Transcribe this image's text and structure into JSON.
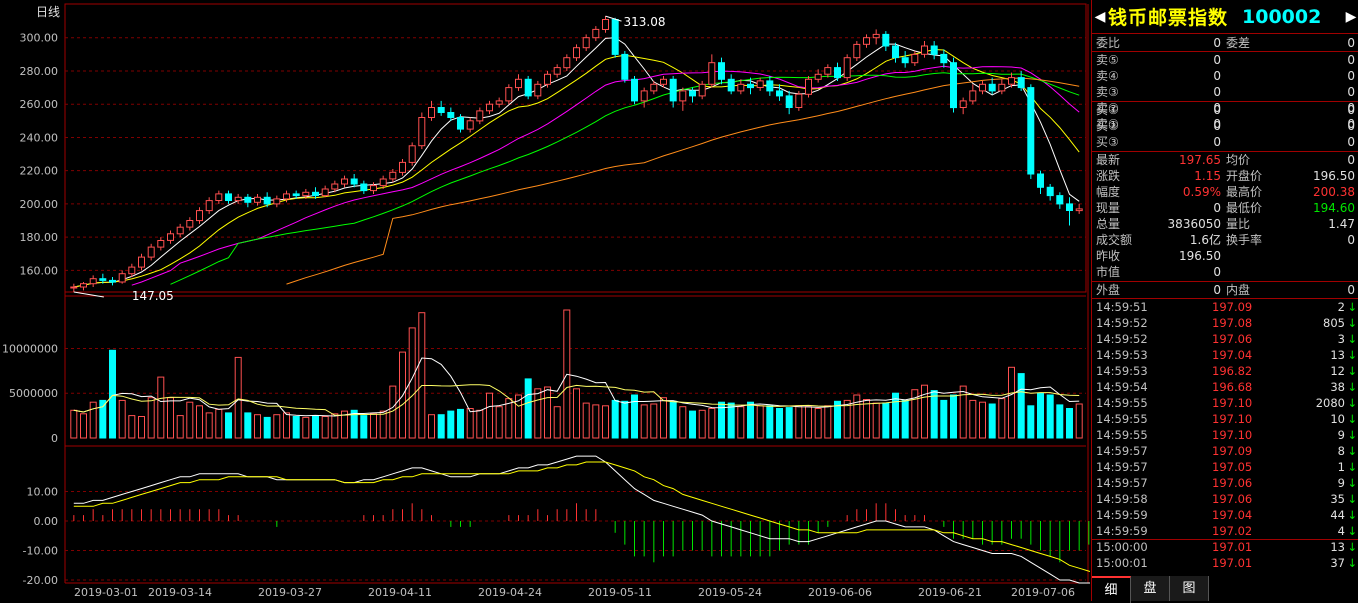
{
  "chart": {
    "period_label": "日线",
    "y_ticks": [
      "300.00",
      "280.00",
      "260.00",
      "240.00",
      "220.00",
      "200.00",
      "180.00",
      "160.00"
    ],
    "high_label": "313.08",
    "low_label": "147.05",
    "vol_ticks": [
      "10000000",
      "5000000",
      "0"
    ],
    "macd_ticks": [
      "10.00",
      "0.00",
      "-10.00",
      "-20.00"
    ],
    "x_labels": [
      "2019-03-01",
      "2019-03-14",
      "2019-03-27",
      "2019-04-11",
      "2019-04-24",
      "2019-05-11",
      "2019-05-24",
      "2019-06-06",
      "2019-06-21",
      "2019-07-06"
    ]
  },
  "chart_data": {
    "type": "candlestick",
    "period": "日线",
    "price_ylim": [
      150,
      313
    ],
    "volume_ylim": [
      0,
      14000000
    ],
    "macd_ylim": [
      -20,
      20
    ],
    "candles": [
      [
        150,
        150,
        147,
        152
      ],
      [
        150,
        152,
        148,
        153
      ],
      [
        152,
        155,
        150,
        157
      ],
      [
        155,
        154,
        152,
        158
      ],
      [
        154,
        153,
        151,
        156
      ],
      [
        153,
        158,
        152,
        160
      ],
      [
        158,
        162,
        156,
        164
      ],
      [
        162,
        168,
        160,
        170
      ],
      [
        168,
        174,
        166,
        176
      ],
      [
        174,
        178,
        172,
        180
      ],
      [
        178,
        182,
        176,
        184
      ],
      [
        182,
        186,
        180,
        188
      ],
      [
        186,
        190,
        184,
        192
      ],
      [
        190,
        196,
        188,
        198
      ],
      [
        196,
        202,
        194,
        204
      ],
      [
        202,
        206,
        200,
        208
      ],
      [
        206,
        202,
        200,
        208
      ],
      [
        202,
        204,
        200,
        206
      ],
      [
        204,
        201,
        198,
        206
      ],
      [
        201,
        204,
        199,
        206
      ],
      [
        204,
        200,
        198,
        207
      ],
      [
        200,
        203,
        198,
        205
      ],
      [
        203,
        206,
        201,
        208
      ],
      [
        206,
        205,
        203,
        208
      ],
      [
        205,
        207,
        203,
        209
      ],
      [
        207,
        205,
        203,
        210
      ],
      [
        205,
        209,
        204,
        211
      ],
      [
        209,
        212,
        207,
        214
      ],
      [
        212,
        215,
        210,
        217
      ],
      [
        215,
        212,
        210,
        218
      ],
      [
        212,
        208,
        206,
        214
      ],
      [
        208,
        211,
        206,
        213
      ],
      [
        211,
        215,
        209,
        217
      ],
      [
        215,
        219,
        213,
        221
      ],
      [
        219,
        225,
        217,
        227
      ],
      [
        225,
        235,
        223,
        237
      ],
      [
        235,
        252,
        233,
        255
      ],
      [
        252,
        258,
        250,
        262
      ],
      [
        258,
        255,
        253,
        262
      ],
      [
        255,
        252,
        250,
        258
      ],
      [
        252,
        245,
        243,
        254
      ],
      [
        245,
        250,
        243,
        252
      ],
      [
        250,
        256,
        248,
        258
      ],
      [
        256,
        260,
        254,
        262
      ],
      [
        260,
        262,
        258,
        264
      ],
      [
        262,
        270,
        260,
        272
      ],
      [
        270,
        275,
        268,
        278
      ],
      [
        275,
        265,
        263,
        277
      ],
      [
        265,
        272,
        263,
        274
      ],
      [
        272,
        278,
        270,
        280
      ],
      [
        278,
        282,
        276,
        284
      ],
      [
        282,
        288,
        280,
        290
      ],
      [
        288,
        294,
        286,
        296
      ],
      [
        294,
        300,
        292,
        302
      ],
      [
        300,
        305,
        298,
        307
      ],
      [
        305,
        311,
        303,
        313
      ],
      [
        311,
        290,
        288,
        312
      ],
      [
        290,
        275,
        273,
        292
      ],
      [
        275,
        262,
        260,
        277
      ],
      [
        262,
        268,
        258,
        270
      ],
      [
        268,
        272,
        266,
        274
      ],
      [
        272,
        275,
        270,
        277
      ],
      [
        275,
        262,
        258,
        277
      ],
      [
        262,
        268,
        256,
        270
      ],
      [
        268,
        265,
        261,
        270
      ],
      [
        265,
        272,
        263,
        274
      ],
      [
        272,
        285,
        270,
        290
      ],
      [
        285,
        275,
        272,
        288
      ],
      [
        275,
        268,
        266,
        278
      ],
      [
        268,
        272,
        266,
        275
      ],
      [
        272,
        270,
        266,
        276
      ],
      [
        270,
        274,
        268,
        276
      ],
      [
        274,
        268,
        265,
        277
      ],
      [
        268,
        265,
        262,
        272
      ],
      [
        265,
        258,
        254,
        268
      ],
      [
        258,
        266,
        256,
        268
      ],
      [
        266,
        275,
        264,
        277
      ],
      [
        275,
        278,
        273,
        281
      ],
      [
        278,
        282,
        276,
        284
      ],
      [
        282,
        276,
        274,
        285
      ],
      [
        276,
        288,
        274,
        290
      ],
      [
        288,
        296,
        286,
        298
      ],
      [
        296,
        300,
        294,
        302
      ],
      [
        300,
        302,
        296,
        305
      ],
      [
        302,
        295,
        292,
        304
      ],
      [
        295,
        288,
        285,
        297
      ],
      [
        288,
        285,
        282,
        292
      ],
      [
        285,
        290,
        283,
        292
      ],
      [
        290,
        295,
        288,
        298
      ],
      [
        295,
        290,
        287,
        298
      ],
      [
        290,
        285,
        282,
        293
      ],
      [
        285,
        258,
        255,
        288
      ],
      [
        258,
        262,
        254,
        264
      ],
      [
        262,
        268,
        260,
        272
      ],
      [
        268,
        272,
        266,
        274
      ],
      [
        272,
        268,
        266,
        276
      ],
      [
        268,
        272,
        266,
        275
      ],
      [
        272,
        276,
        270,
        279
      ],
      [
        276,
        270,
        268,
        280
      ],
      [
        270,
        218,
        215,
        272
      ],
      [
        218,
        210,
        206,
        220
      ],
      [
        210,
        205,
        202,
        212
      ],
      [
        205,
        200,
        197,
        207
      ],
      [
        200,
        196,
        187,
        204
      ],
      [
        196,
        197,
        194,
        200
      ]
    ],
    "volume": [
      3100000,
      2700000,
      4000000,
      4200000,
      9800000,
      4200000,
      2500000,
      2400000,
      4500000,
      6800000,
      4500000,
      2500000,
      4000000,
      3600000,
      2800000,
      3200000,
      2800000,
      9000000,
      2800000,
      2600000,
      2300000,
      2600000,
      2800000,
      2400000,
      2300000,
      2500000,
      2400000,
      2700000,
      3000000,
      3100000,
      2500000,
      2700000,
      3000000,
      5800000,
      9600000,
      12300000,
      14000000,
      2600000,
      2600000,
      3000000,
      3200000,
      3300000,
      3100000,
      5000000,
      3500000,
      4400000,
      4800000,
      6600000,
      5500000,
      5700000,
      3500000,
      14300000,
      5500000,
      3900000,
      3700000,
      3600000,
      4200000,
      4100000,
      4800000,
      3700000,
      3800000,
      4500000,
      4100000,
      3500000,
      3000000,
      3100000,
      3300000,
      4000000,
      3900000,
      3500000,
      4000000,
      3600000,
      3600000,
      3300000,
      3400000,
      3600000,
      3500000,
      3300000,
      3600000,
      4100000,
      4200000,
      4800000,
      4300000,
      3900000,
      3900000,
      5000000,
      4200000,
      5400000,
      5900000,
      5300000,
      4200000,
      4800000,
      5800000,
      4200000,
      4000000,
      3800000,
      4400000,
      7900000,
      7200000,
      3600000,
      5000000,
      4800000,
      3700000,
      3300000,
      3800000
    ],
    "volume_colors": [
      "up",
      "cyan"
    ],
    "macd": {
      "dif": [
        6,
        6,
        7,
        7,
        8,
        9,
        10,
        11,
        12,
        13,
        14,
        15,
        15,
        16,
        16,
        16,
        16,
        16,
        15,
        15,
        15,
        14,
        14,
        14,
        14,
        14,
        14,
        14,
        13,
        13,
        14,
        14,
        15,
        16,
        17,
        18,
        18,
        17,
        16,
        15,
        15,
        15,
        16,
        16,
        16,
        17,
        18,
        18,
        19,
        19,
        20,
        21,
        22,
        22,
        22,
        20,
        17,
        14,
        11,
        9,
        7,
        6,
        5,
        4,
        3,
        2,
        0,
        -1,
        -2,
        -3,
        -4,
        -5,
        -6,
        -6,
        -6,
        -7,
        -7,
        -6,
        -5,
        -4,
        -3,
        -2,
        -1,
        0,
        0,
        -1,
        -2,
        -2,
        -2,
        -3,
        -5,
        -7,
        -8,
        -9,
        -10,
        -11,
        -11,
        -11,
        -12,
        -14,
        -16,
        -18,
        -20,
        -20,
        -21,
        -21,
        -21
      ],
      "dea": [
        5,
        5,
        5,
        6,
        6,
        7,
        8,
        9,
        10,
        11,
        12,
        13,
        13,
        14,
        14,
        14,
        15,
        15,
        15,
        15,
        15,
        15,
        14,
        14,
        14,
        14,
        14,
        14,
        13,
        13,
        13,
        13,
        14,
        14,
        15,
        15,
        16,
        16,
        16,
        16,
        16,
        16,
        16,
        16,
        16,
        16,
        17,
        17,
        17,
        18,
        18,
        19,
        19,
        20,
        20,
        20,
        19,
        18,
        17,
        15,
        14,
        12,
        11,
        9,
        8,
        7,
        6,
        5,
        4,
        3,
        2,
        1,
        0,
        -1,
        -2,
        -3,
        -3,
        -4,
        -4,
        -4,
        -4,
        -4,
        -3,
        -3,
        -3,
        -3,
        -3,
        -3,
        -3,
        -3,
        -4,
        -4,
        -5,
        -6,
        -6,
        -7,
        -7,
        -8,
        -9,
        -10,
        -11,
        -12,
        -13,
        -15,
        -16,
        -17,
        -18
      ]
    },
    "ma": {
      "colors": [
        "#ffffff",
        "#ffff00",
        "#ff00ff",
        "#00ff00",
        "#ff8c1a"
      ]
    }
  },
  "panel": {
    "name": "钱币邮票指数",
    "code": "100002",
    "arrow_left": "◀",
    "arrow_right": "▶",
    "weibi_label": "委比",
    "weibi_value": "0",
    "weicha_label": "委差",
    "weicha_value": "0",
    "asks": [
      {
        "label": "卖⑤",
        "price": "0",
        "qty": "0"
      },
      {
        "label": "卖④",
        "price": "0",
        "qty": "0"
      },
      {
        "label": "卖③",
        "price": "0",
        "qty": "0"
      },
      {
        "label": "卖②",
        "price": "0",
        "qty": "0"
      },
      {
        "label": "卖①",
        "price": "0",
        "qty": "0"
      }
    ],
    "bids": [
      {
        "label": "买①",
        "price": "0",
        "qty": "0"
      },
      {
        "label": "买②",
        "price": "0",
        "qty": "0"
      },
      {
        "label": "买③",
        "price": "0",
        "qty": "0"
      }
    ],
    "quote": {
      "zuixin_label": "最新",
      "zuixin": "197.65",
      "junjia_label": "均价",
      "junjia": "0",
      "zhangdie_label": "涨跌",
      "zhangdie": "1.15",
      "kaipan_label": "开盘价",
      "kaipan": "196.50",
      "fudu_label": "幅度",
      "fudu": "0.59%",
      "zuigao_label": "最高价",
      "zuigao": "200.38",
      "xianliang_label": "现量",
      "xianliang": "0",
      "zuidi_label": "最低价",
      "zuidi": "194.60",
      "zongliang_label": "总量",
      "zongliang": "3836050",
      "liangbi_label": "量比",
      "liangbi": "1.47",
      "chengjiao_label": "成交额",
      "chengjiao": "1.6亿",
      "huanshou_label": "换手率",
      "huanshou": "0",
      "zuoshou_label": "昨收",
      "zuoshou": "196.50",
      "shizhi_label": "市值",
      "shizhi": "0",
      "waipan_label": "外盘",
      "waipan": "0",
      "neipan_label": "内盘",
      "neipan": "0"
    },
    "ticks": [
      {
        "time": "14:59:51",
        "price": "197.09",
        "qty": "2"
      },
      {
        "time": "14:59:52",
        "price": "197.08",
        "qty": "805"
      },
      {
        "time": "14:59:52",
        "price": "197.06",
        "qty": "3"
      },
      {
        "time": "14:59:53",
        "price": "197.04",
        "qty": "13"
      },
      {
        "time": "14:59:53",
        "price": "196.82",
        "qty": "12"
      },
      {
        "time": "14:59:54",
        "price": "196.68",
        "qty": "38"
      },
      {
        "time": "14:59:55",
        "price": "197.10",
        "qty": "2080"
      },
      {
        "time": "14:59:55",
        "price": "197.10",
        "qty": "10"
      },
      {
        "time": "14:59:55",
        "price": "197.10",
        "qty": "9"
      },
      {
        "time": "14:59:57",
        "price": "197.09",
        "qty": "8"
      },
      {
        "time": "14:59:57",
        "price": "197.05",
        "qty": "1"
      },
      {
        "time": "14:59:57",
        "price": "197.06",
        "qty": "9"
      },
      {
        "time": "14:59:58",
        "price": "197.06",
        "qty": "35"
      },
      {
        "time": "14:59:59",
        "price": "197.04",
        "qty": "44"
      },
      {
        "time": "14:59:59",
        "price": "197.02",
        "qty": "4"
      },
      {
        "time": "15:00:00",
        "price": "197.01",
        "qty": "13"
      },
      {
        "time": "15:00:01",
        "price": "197.01",
        "qty": "37"
      }
    ],
    "tick_arrow": "↓",
    "tabs": [
      "细",
      "盘",
      "图"
    ]
  }
}
